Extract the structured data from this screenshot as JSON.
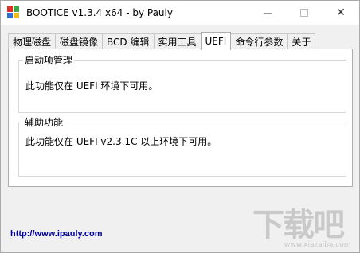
{
  "window": {
    "title": "BOOTICE v1.3.4 x64 - by Pauly"
  },
  "tabs": [
    {
      "label": "物理磁盘",
      "active": false
    },
    {
      "label": "磁盘镜像",
      "active": false
    },
    {
      "label": "BCD 编辑",
      "active": false
    },
    {
      "label": "实用工具",
      "active": false
    },
    {
      "label": "UEFI",
      "active": true
    },
    {
      "label": "命令行参数",
      "active": false
    },
    {
      "label": "关于",
      "active": false
    }
  ],
  "groups": [
    {
      "title": "启动项管理",
      "text": "此功能仅在 UEFI 环境下可用。"
    },
    {
      "title": "辅助功能",
      "text": "此功能仅在 UEFI v2.3.1C 以上环境下可用。"
    }
  ],
  "footer": {
    "link": "http://www.ipauly.com"
  },
  "watermark": {
    "main": "下载吧",
    "sub": "www.xiazaiba.com"
  },
  "colors": {
    "link": "#0000a0",
    "icon_red": "#e0302a",
    "icon_green": "#3aa845",
    "icon_blue": "#2e6fd3",
    "icon_yellow": "#f2b91c"
  }
}
